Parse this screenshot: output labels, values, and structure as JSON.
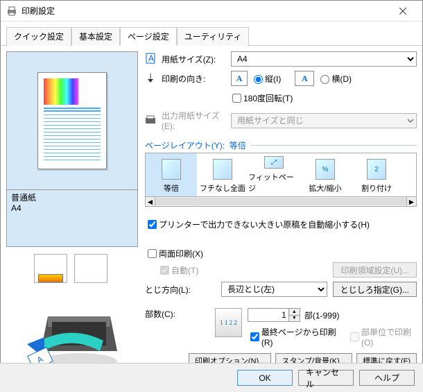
{
  "window": {
    "title": "印刷設定"
  },
  "tabs": [
    "クイック設定",
    "基本設定",
    "ページ設定",
    "ユーティリティ"
  ],
  "active_tab": 2,
  "preview": {
    "paper_type": "普通紙",
    "paper_size": "A4"
  },
  "page_size": {
    "label": "用紙サイズ(Z):",
    "value": "A4"
  },
  "orientation": {
    "label": "印刷の向き:",
    "portrait": "縦(I)",
    "landscape": "横(D)",
    "rotate180": "180度回転(T)"
  },
  "output_size": {
    "label": "出力用紙サイズ(E):",
    "value": "用紙サイズと同じ"
  },
  "layout": {
    "label": "ページレイアウト(Y):",
    "value": "等倍",
    "items": [
      "等倍",
      "フチなし全面",
      "フィットページ",
      "拡大/縮小",
      "割り付け"
    ]
  },
  "auto_shrink": {
    "label": "プリンターで出力できない大きい原稿を自動縮小する(H)",
    "checked": true
  },
  "duplex": {
    "label": "両面印刷(X)",
    "checked": false,
    "auto": "自動(T)",
    "area_btn": "印刷領域設定(U)..."
  },
  "binding": {
    "label": "とじ方向(L):",
    "value": "長辺とじ(左)",
    "margin_btn": "とじしろ指定(G)..."
  },
  "copies": {
    "label": "部数(C):",
    "value": "1",
    "range": "部(1-999)",
    "last_first": "最終ページから印刷(R)",
    "collate": "部単位で印刷(O)"
  },
  "bottom_buttons": [
    "印刷オプション(N)...",
    "スタンプ/背景(K)...",
    "標準に戻す(F)"
  ],
  "footer": {
    "ok": "OK",
    "cancel": "キャンセル",
    "help": "ヘルプ"
  }
}
